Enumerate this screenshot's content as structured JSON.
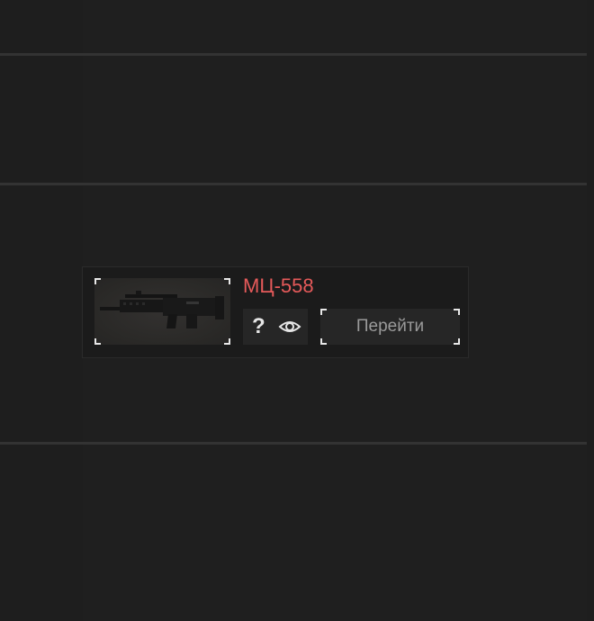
{
  "item": {
    "name": "МЦ-558",
    "image_icon": "rifle-image",
    "name_color": "#e65a5a"
  },
  "actions": {
    "help_icon": "question-icon",
    "help_glyph": "?",
    "preview_icon": "eye-icon",
    "go_label": "Перейти"
  }
}
